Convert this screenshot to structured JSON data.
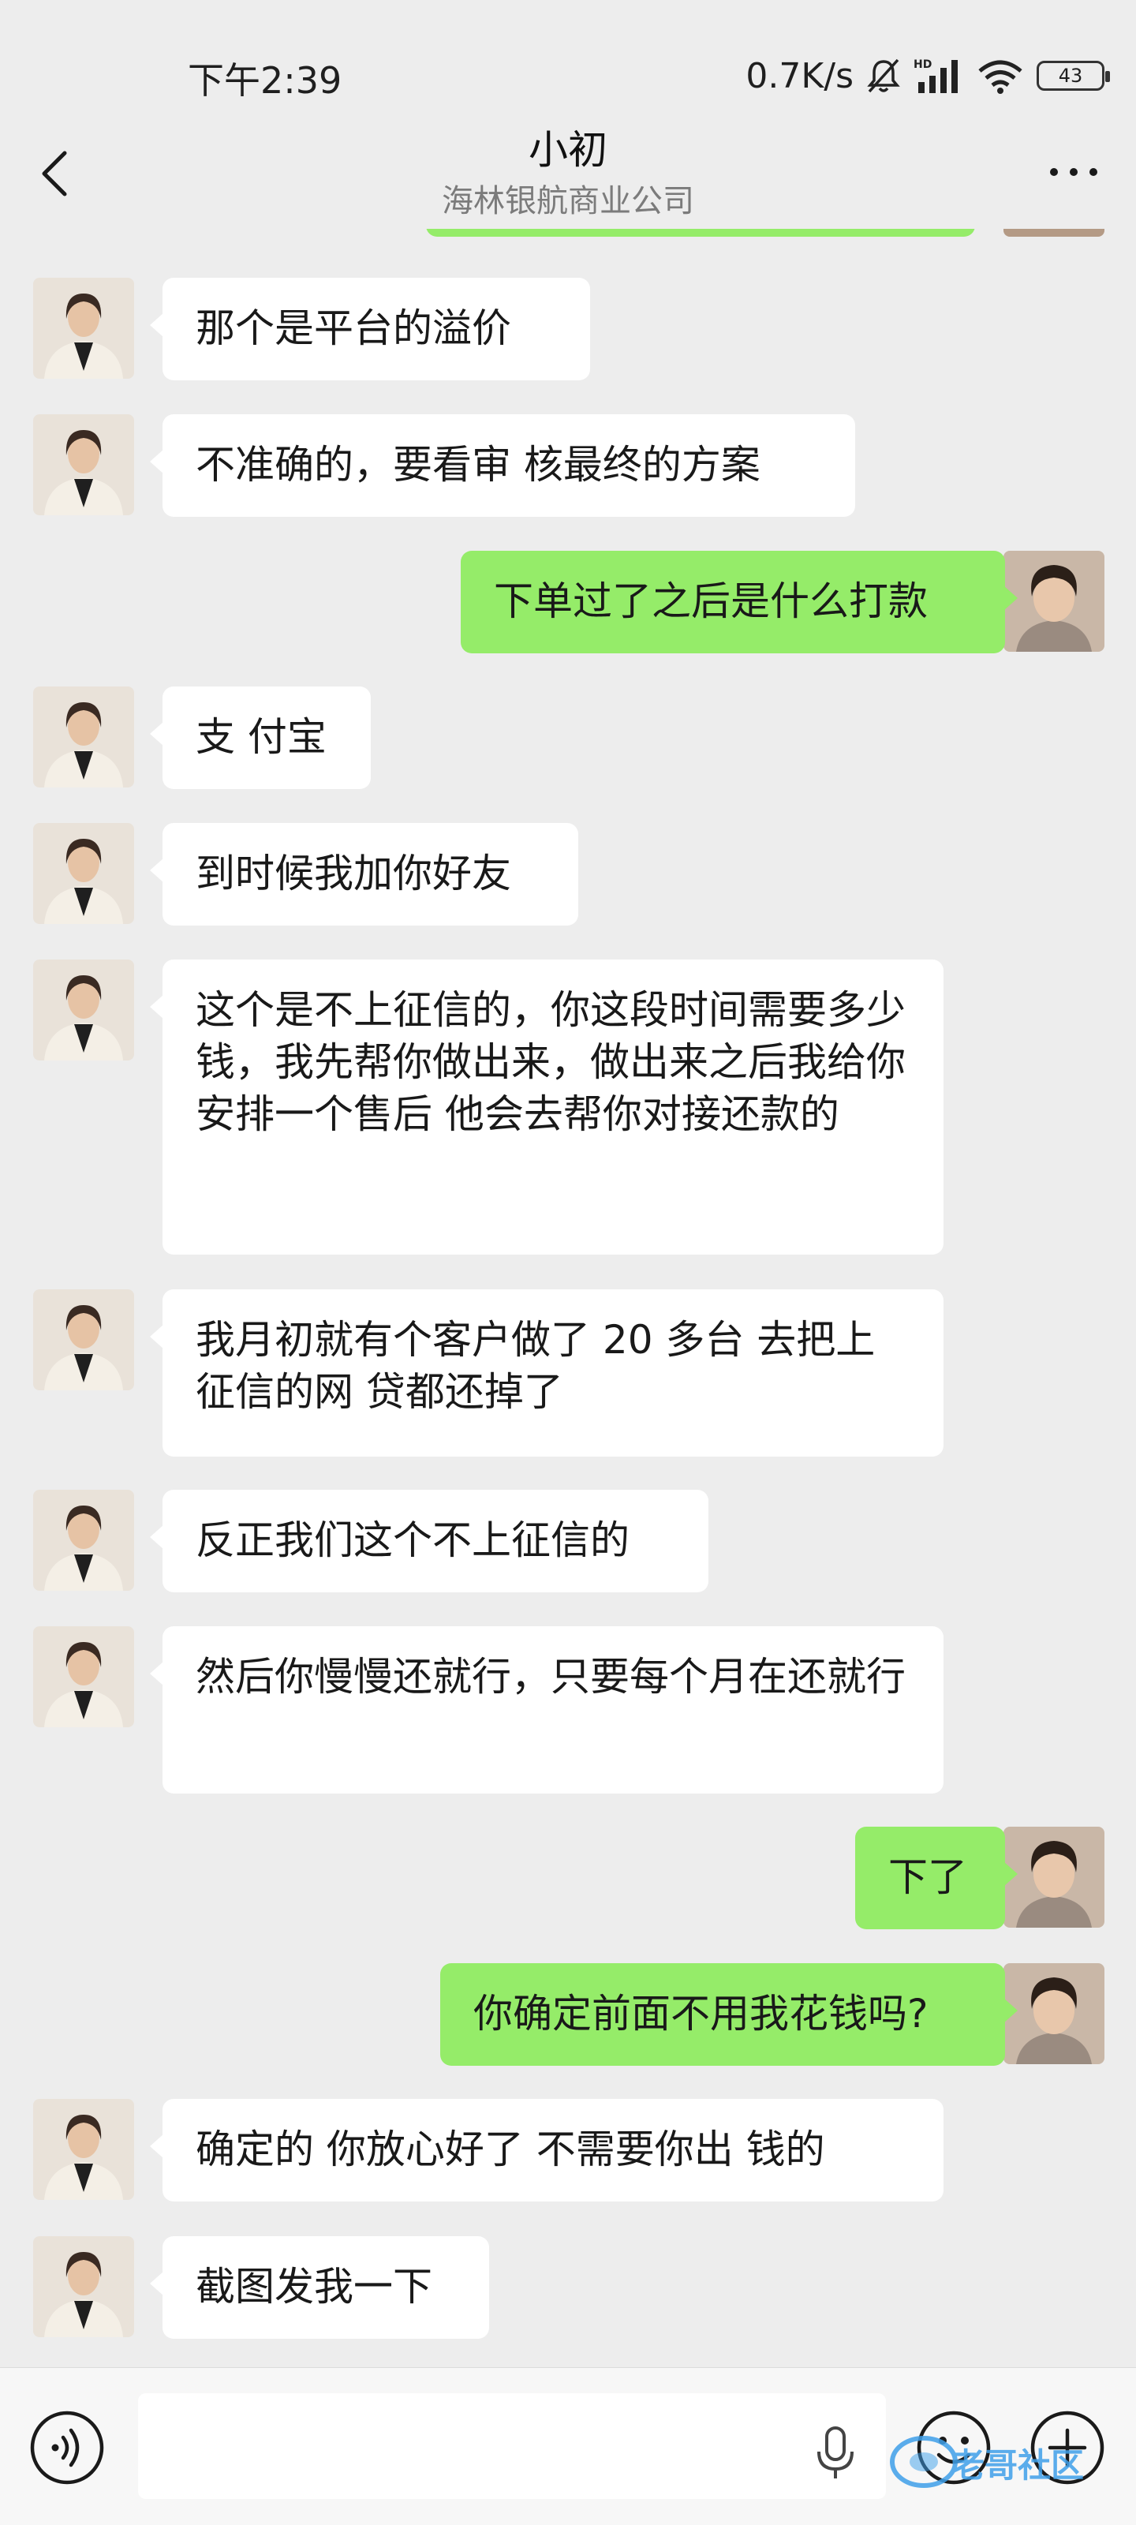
{
  "status_bar": {
    "time": "下午2:39",
    "net_speed": "0.7K/s",
    "battery": "43"
  },
  "header": {
    "title": "小初",
    "subtitle": "海林银航商业公司"
  },
  "messages": [
    {
      "side": "left",
      "text": "那个是平台的溢价"
    },
    {
      "side": "left",
      "text": "不准确的，要看审 核最终的方案"
    },
    {
      "side": "right",
      "text": "下单过了之后是什么打款"
    },
    {
      "side": "left",
      "text": "支 付宝"
    },
    {
      "side": "left",
      "text": "到时候我加你好友"
    },
    {
      "side": "left",
      "text": "这个是不上征信的，你这段时间需要多少钱，我先帮你做出来，做出来之后我给你安排一个售后 他会去帮你对接还款的"
    },
    {
      "side": "left",
      "text": "我月初就有个客户做了 20 多台 去把上征信的网 贷都还掉了"
    },
    {
      "side": "left",
      "text": "反正我们这个不上征信的"
    },
    {
      "side": "left",
      "text": "然后你慢慢还就行，只要每个月在还就行"
    },
    {
      "side": "right",
      "text": "下了"
    },
    {
      "side": "right",
      "text": "你确定前面不用我花钱吗?"
    },
    {
      "side": "left",
      "text": "确定的 你放心好了 不需要你出 钱的"
    },
    {
      "side": "left",
      "text": "截图发我一下"
    }
  ],
  "input_bar": {
    "placeholder": ""
  },
  "watermark": {
    "text": "老哥社区"
  },
  "colors": {
    "background": "#ededed",
    "sent_bubble": "#95ec69",
    "received_bubble": "#ffffff",
    "input_bar": "#f7f7f7"
  },
  "icons": [
    "back-arrow-icon",
    "more-icon",
    "voice-icon",
    "microphone-icon",
    "emoji-icon",
    "plus-icon",
    "mute-bell-icon",
    "signal-icon",
    "wifi-icon",
    "battery-icon"
  ]
}
